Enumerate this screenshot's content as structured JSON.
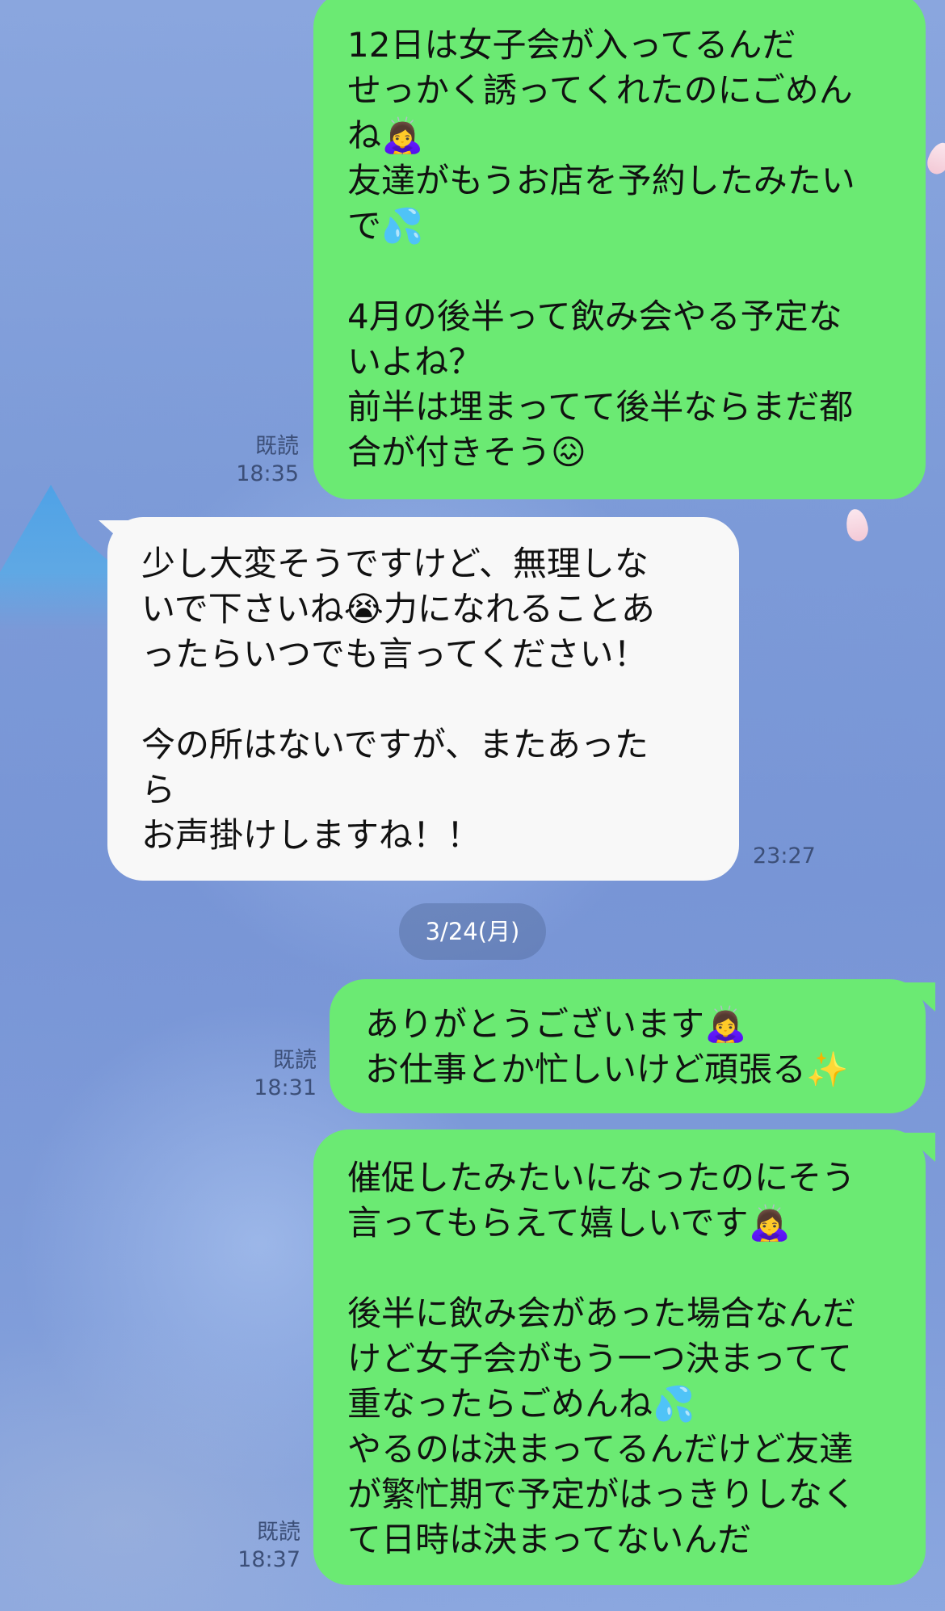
{
  "messages": [
    {
      "direction": "outgoing",
      "text": "12日は女子会が入ってるんだ\nせっかく誘ってくれたのにごめん\nね🙇‍♀️\n友達がもうお店を予約したみたい\nで💦\n\n4月の後半って飲み会やる予定な\nいよね？\n前半は埋まってて後半ならまだ都\n合が付きそう😖",
      "read": "既読",
      "time": "18:35"
    },
    {
      "direction": "incoming",
      "text": "少し大変そうですけど、無理しな\nいで下さいね😭力になれることあ\nったらいつでも言ってください！\n\n今の所はないですが、またあった\nら\nお声掛けしますね！！",
      "time": "23:27"
    },
    {
      "direction": "outgoing",
      "text": "ありがとうございます🙇‍♀️\nお仕事とか忙しいけど頑張る✨",
      "read": "既読",
      "time": "18:31"
    },
    {
      "direction": "outgoing",
      "text": "催促したみたいになったのにそう\n言ってもらえて嬉しいです🙇‍♀️\n\n後半に飲み会があった場合なんだ\nけど女子会がもう一つ決まってて\n重なったらごめんね💦\nやるのは決まってるんだけど友達\nが繁忙期で予定がはっきりしなく\nて日時は決まってないんだ",
      "read": "既読",
      "time": "18:37"
    }
  ],
  "date_separator": "3/24(月)",
  "colors": {
    "outgoing_bubble": "#6bea73",
    "incoming_bubble": "#f8f8f8",
    "background": "#7f9cd9",
    "meta_text": "#3c4f78"
  }
}
